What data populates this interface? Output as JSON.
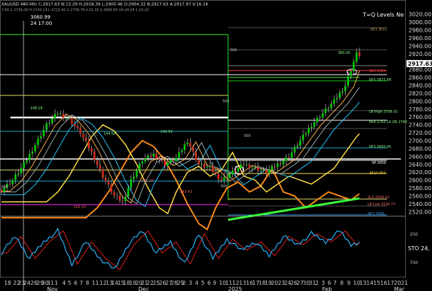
{
  "header": {
    "symbol": "XAUUSD",
    "timeframe": "480-Min",
    "ohlc_line": "XAUUSD 480-Min C:2917.63 N:13.29 H:2918.39 L:2900.46 O:2904.32 B:2917.63 A:2917.97 V:16.1K",
    "line2": "7.80 C:2736.09 H:2743.14 L:2722.40 C:2738.78 V:31.1K S:3060.99 18-24-24 1:24:23",
    "cursor_price": "3060.99",
    "cursor_time": "24 17:00",
    "study_name": "T=Q Levels Ne"
  },
  "price_axis": {
    "ticks": [
      "3020.00",
      "3000.00",
      "2980.00",
      "2960.00",
      "2940.00",
      "2920.00",
      "2900.00",
      "2880.00",
      "2860.00",
      "2840.00",
      "2820.00",
      "2800.00",
      "2780.00",
      "2760.00",
      "2740.00",
      "2720.00",
      "2700.00",
      "2680.00",
      "2660.00",
      "2640.00",
      "2620.00",
      "2600.00",
      "2580.00",
      "2560.00",
      "2540.00",
      "2520.00"
    ],
    "last_price": "2917.63"
  },
  "osc_axis": {
    "ticks": [
      "250",
      "250",
      "250",
      "750"
    ],
    "label": "STO 24,"
  },
  "time_axis": {
    "day_labels": [
      "18",
      "22",
      "23",
      "24",
      "28",
      "29",
      "30",
      "31",
      "1",
      "4",
      "5",
      "6",
      "7",
      "8",
      "11",
      "12",
      "13",
      "14",
      "15",
      "18",
      "19",
      "20",
      "21",
      "22",
      "25",
      "26",
      "27",
      "28",
      "29",
      "2",
      "3",
      "4",
      "5",
      "6",
      "9",
      "10",
      "11",
      "12",
      "13",
      "16",
      "17",
      "18",
      "19",
      "20",
      "23",
      "24",
      "26",
      "27",
      "30",
      "31",
      "2",
      "3",
      "6",
      "7",
      "8",
      "9",
      "10",
      "13",
      "14",
      "15",
      "16",
      "17",
      "20",
      "21",
      "22",
      "23",
      "24",
      "27",
      "28",
      "29",
      "30",
      "31",
      "3",
      "4",
      "5",
      "6",
      "7",
      "10",
      "11",
      "12",
      "13",
      "14",
      "17",
      "24",
      "3"
    ],
    "month_labels": [
      "Nov",
      "Dec",
      "2025",
      "Feb",
      "Mar"
    ],
    "tail_labels": [
      "3",
      "4",
      "5",
      "6",
      "7",
      "10",
      "11",
      "12",
      "13",
      "14",
      "17",
      "24",
      "3"
    ]
  },
  "annotations": {
    "level_1": "198.18",
    "level_2": "144.54",
    "level_3": "142.99",
    "level_4": "- 101.10",
    "level_5": "- 143.42",
    "level_6": "- 101.23",
    "level_7": "380.00",
    "t_2500": "500",
    "t_500a": "500",
    "t_500b": "500",
    "t_500c": "500",
    "t_500d": "500",
    "r_0": "0E3 3011",
    "r_1": "0E2 2952",
    "r_2": "0E5 2877.68",
    "r_3": "LB High 2798.01",
    "r_4": "0E4 2763.10 OB 2760",
    "r_5": "0E3 2693.45",
    "r_6": "SP 2656",
    "r_7": "2624.004",
    "r_8": "0L3 2554.15",
    "r_9": "LB Low 2536.73",
    "r_10": "0E7 2500"
  },
  "colors": {
    "background": "#000000",
    "up_candle": "#00c800",
    "down_candle": "#d03020",
    "osc_fast": "#2ab4ff",
    "osc_slow": "#e02020",
    "ma_orange": "#ff8c1a",
    "ma_yellow": "#ffe04a",
    "ma_cyan": "#22c8ff",
    "ma_lime": "#3cff3c",
    "grid_magenta": "#ff30ff"
  },
  "chart_data": {
    "type": "candlestick",
    "ylim": [
      2510,
      3030
    ],
    "bars": 128,
    "price_path": [
      [
        0,
        2575
      ],
      [
        4,
        2600
      ],
      [
        8,
        2640
      ],
      [
        12,
        2690
      ],
      [
        16,
        2740
      ],
      [
        20,
        2770
      ],
      [
        24,
        2755
      ],
      [
        28,
        2720
      ],
      [
        32,
        2670
      ],
      [
        36,
        2610
      ],
      [
        40,
        2560
      ],
      [
        43,
        2545
      ],
      [
        46,
        2600
      ],
      [
        50,
        2650
      ],
      [
        54,
        2665
      ],
      [
        58,
        2640
      ],
      [
        62,
        2655
      ],
      [
        66,
        2700
      ],
      [
        70,
        2640
      ],
      [
        74,
        2630
      ],
      [
        78,
        2600
      ],
      [
        82,
        2620
      ],
      [
        86,
        2640
      ],
      [
        90,
        2630
      ],
      [
        94,
        2620
      ],
      [
        98,
        2640
      ],
      [
        102,
        2660
      ],
      [
        106,
        2700
      ],
      [
        110,
        2740
      ],
      [
        114,
        2770
      ],
      [
        118,
        2800
      ],
      [
        122,
        2840
      ],
      [
        124,
        2880
      ],
      [
        126,
        2920
      ],
      [
        127,
        2917.63
      ]
    ],
    "osc_path": [
      [
        0,
        40
      ],
      [
        5,
        70
      ],
      [
        10,
        30
      ],
      [
        15,
        60
      ],
      [
        20,
        80
      ],
      [
        25,
        20
      ],
      [
        30,
        60
      ],
      [
        35,
        30
      ],
      [
        40,
        10
      ],
      [
        45,
        55
      ],
      [
        50,
        80
      ],
      [
        55,
        40
      ],
      [
        60,
        60
      ],
      [
        65,
        20
      ],
      [
        70,
        75
      ],
      [
        75,
        30
      ],
      [
        80,
        65
      ],
      [
        85,
        45
      ],
      [
        90,
        60
      ],
      [
        95,
        35
      ],
      [
        100,
        70
      ],
      [
        105,
        55
      ],
      [
        110,
        75
      ],
      [
        115,
        60
      ],
      [
        120,
        80
      ],
      [
        124,
        55
      ],
      [
        127,
        60
      ]
    ],
    "levels": [
      {
        "price": 2656,
        "color": "#ffffff"
      },
      {
        "price": 2624,
        "color": "#ffe04a"
      },
      {
        "price": 2554,
        "color": "#ff30ff"
      },
      {
        "price": 2900,
        "color": "#ffffff"
      },
      {
        "price": 2760,
        "color": "#ffffff"
      }
    ]
  }
}
